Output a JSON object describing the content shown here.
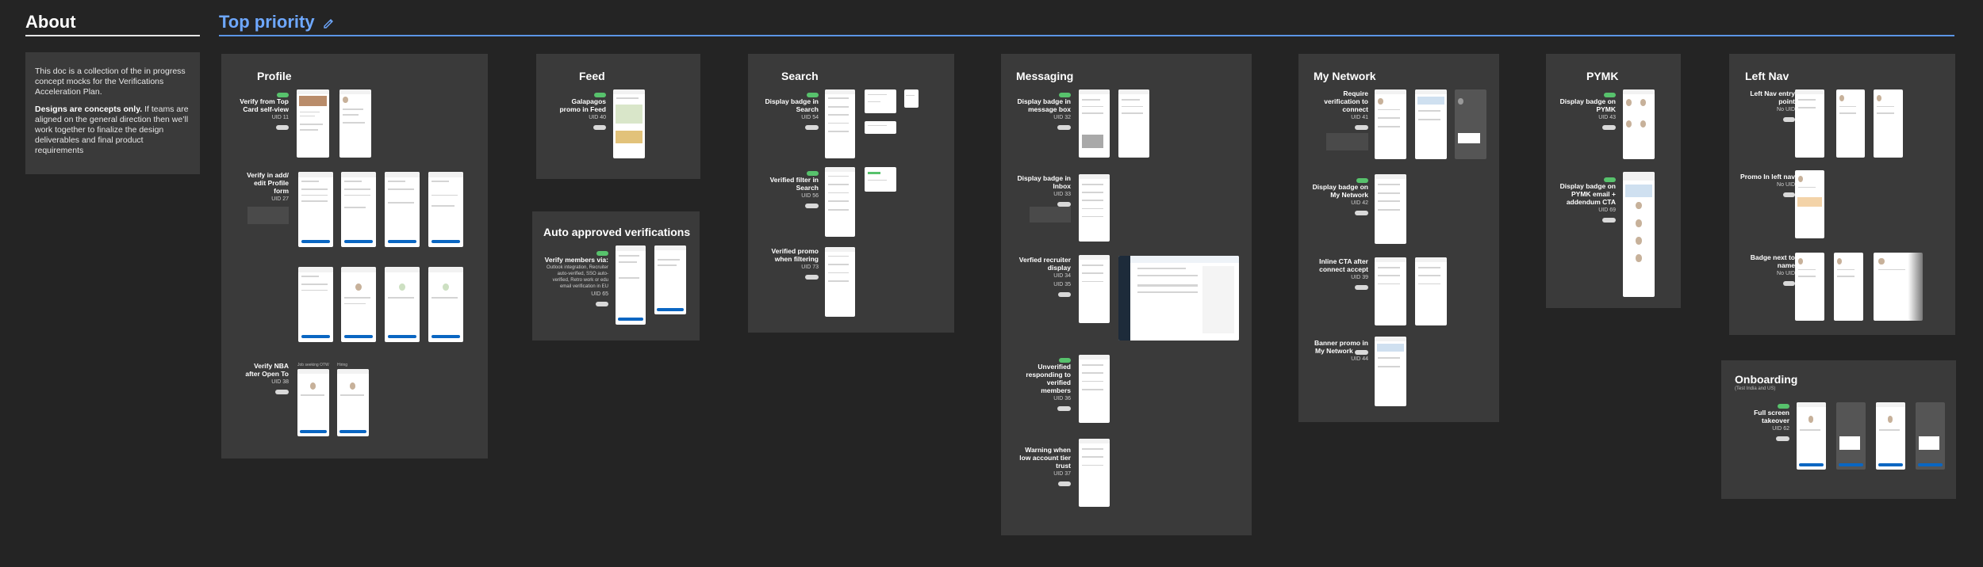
{
  "about": {
    "title": "About",
    "p1": "This doc is a collection of the in progress concept mocks for the Verifications Acceleration Plan.",
    "p2_bold": "Designs are concepts only.",
    "p2_rest": " If teams are aligned on the general direction then we’ll work together to finalize the design deliverables and final product requirements"
  },
  "top_priority": {
    "title": "Top priority",
    "edit_icon": "pencil-icon"
  },
  "colors": {
    "accent": "#6ea8ff",
    "panel": "#3a3a3a",
    "background": "#242424",
    "tag_green": "#57c26c",
    "cta_blue": "#0a66c2"
  },
  "sections": {
    "profile": {
      "title": "Profile",
      "items": [
        {
          "label": "Verify from Top Card self-view",
          "uid": "UID 11"
        },
        {
          "label": "Verify in add/ edit Profile form",
          "uid": "UID 27"
        },
        {
          "label": "Verify NBA after Open To",
          "uid": "UID 38"
        }
      ],
      "captions": [
        "Job seeking OTW",
        "Hiring"
      ]
    },
    "feed": {
      "title": "Feed",
      "items": [
        {
          "label": "Galapagos promo in Feed",
          "uid": "UID 40"
        }
      ]
    },
    "auto": {
      "title": "Auto approved verifications",
      "items": [
        {
          "label": "Verify members via:",
          "detail": "Outlook integration, Recruiter auto-verified, SSO auto-verified, Retro work or edu email verification in EU",
          "uid": "UID 65"
        }
      ]
    },
    "search": {
      "title": "Search",
      "items": [
        {
          "label": "Display badge in Search",
          "uid": "UID 54"
        },
        {
          "label": "Verified filter in Search",
          "uid": "UID 56"
        },
        {
          "label": "Verified promo when filtering",
          "uid": "UID 73"
        }
      ]
    },
    "messaging": {
      "title": "Messaging",
      "items": [
        {
          "label": "Display badge in message box",
          "uid": "UID 32"
        },
        {
          "label": "Display badge in Inbox",
          "uid": "UID 33"
        },
        {
          "label": "Verfied recruiter display",
          "uid": "UID 34",
          "uid2": "UID 35"
        },
        {
          "label": "Unverified responding to verified members",
          "uid": "UID 36"
        },
        {
          "label": "Warning when low account tier trust",
          "uid": "UID 37"
        }
      ]
    },
    "network": {
      "title": "My Network",
      "items": [
        {
          "label": "Require verification to connect",
          "uid": "UID 41"
        },
        {
          "label": "Display badge on My Network",
          "uid": "UID 42"
        },
        {
          "label": "Inline CTA after connect accept",
          "uid": "UID 39"
        },
        {
          "label": "Banner promo in My Network",
          "uid": "UID 44"
        }
      ]
    },
    "pymk": {
      "title": "PYMK",
      "items": [
        {
          "label": "Display badge on PYMK",
          "uid": "UID 43"
        },
        {
          "label": "Display badge on PYMK email + addendum CTA",
          "uid": "UID 69"
        }
      ]
    },
    "leftnav": {
      "title": "Left Nav",
      "items": [
        {
          "label": "Left Nav entry point",
          "uid": "No UID"
        },
        {
          "label": "Promo In left nav",
          "uid": "No UID"
        },
        {
          "label": "Badge next to name",
          "uid": "No UID"
        }
      ]
    },
    "onboarding": {
      "title": "Onboarding",
      "subtitle": "(Test India and US)",
      "items": [
        {
          "label": "Full screen takeover",
          "uid": "UID 62"
        }
      ]
    }
  }
}
